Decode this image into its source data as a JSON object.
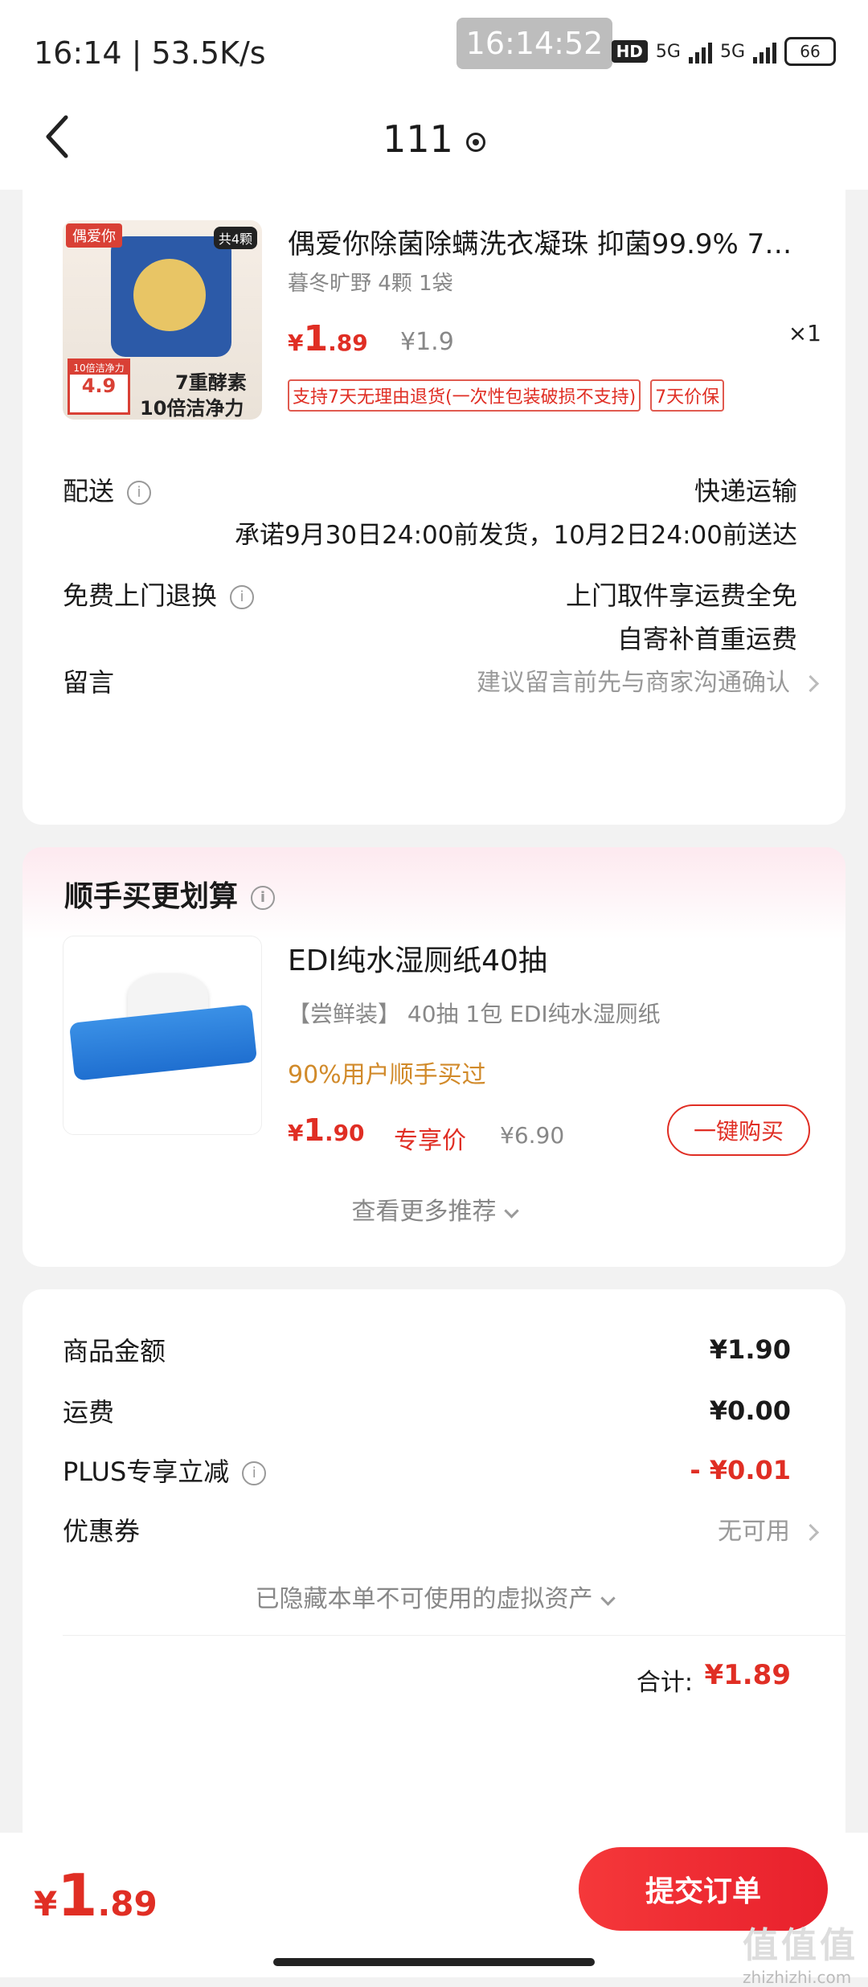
{
  "status_bar": {
    "left_text": "16:14 | 53.5K/s",
    "clock_pill": "16:14:52",
    "hd_badge": "HD",
    "net1": "5G",
    "net2": "5G",
    "battery": "66"
  },
  "nav": {
    "title": "111"
  },
  "product": {
    "title": "偶爱你除菌除螨洗衣凝珠 抑菌99.9% 7…",
    "spec": "暮冬旷野 4颗 1袋",
    "price_yen": "¥",
    "price_int": "1",
    "price_dec": ".89",
    "orig_price": "¥1.9",
    "qty": "×1",
    "tags": [
      "支持7天无理由退货(一次性包装破损不支持)",
      "7天价保"
    ],
    "image_text": {
      "brand": "偶爱你",
      "count": "共4颗",
      "tag_top": "10倍洁净力",
      "tag_price": "4.9",
      "slogan1": "7重酵素",
      "slogan2": "10倍洁净力"
    }
  },
  "delivery": {
    "label": "配送",
    "value": "快递运输",
    "note": "承诺9月30日24:00前发货，10月2日24:00前送达"
  },
  "return_service": {
    "label": "免费上门退换",
    "line1": "上门取件享运费全免",
    "line2": "自寄补首重运费"
  },
  "message": {
    "label": "留言",
    "placeholder": "建议留言前先与商家沟通确认"
  },
  "addon": {
    "section_title": "顺手买更划算",
    "title": "EDI纯水湿厕纸40抽",
    "spec": "【尝鲜装】 40抽 1包 EDI纯水湿厕纸",
    "bought": "90%用户顺手买过",
    "price_yen": "¥",
    "price_int": "1",
    "price_dec": ".90",
    "exclusive_label": "专享价",
    "orig_price": "¥6.90",
    "buy_label": "一键购买",
    "more_label": "查看更多推荐"
  },
  "summary": {
    "goods_label": "商品金额",
    "goods_value": "¥1.90",
    "shipping_label": "运费",
    "shipping_value": "¥0.00",
    "plus_label": "PLUS专享立减",
    "plus_value": "- ¥0.01",
    "coupon_label": "优惠券",
    "coupon_value": "无可用",
    "hidden_assets": "已隐藏本单不可使用的虚拟资产",
    "total_label": "合计:",
    "total_value": "¥1.89"
  },
  "bottom": {
    "yen": "¥",
    "price_int": "1",
    "price_dec": ".89",
    "submit_label": "提交订单"
  },
  "watermark": {
    "logo": "值值值",
    "site": "zhizhizhi.com"
  },
  "colors": {
    "accent_red": "#e02e24",
    "gold": "#d18a2a",
    "muted": "#888888"
  }
}
